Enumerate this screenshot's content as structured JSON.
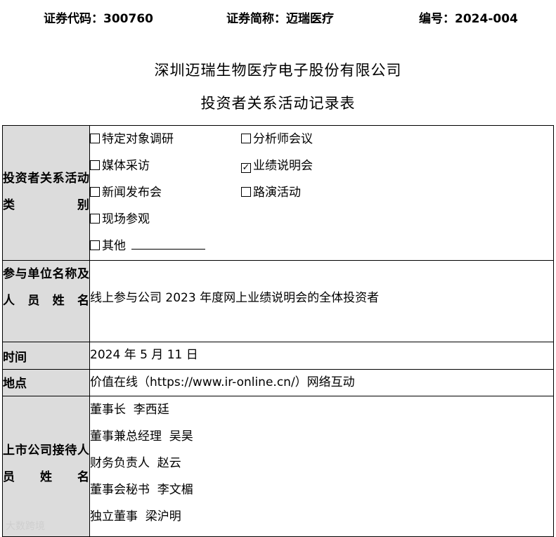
{
  "header": {
    "code": "证券代码：300760",
    "short_name": "证券简称：迈瑞医疗",
    "number": "编号：2024-004"
  },
  "titles": {
    "company": "深圳迈瑞生物医疗电子股份有限公司",
    "form": "投资者关系活动记录表"
  },
  "rows": {
    "category": {
      "label": "投资者关系活动类别",
      "options": [
        {
          "label": "特定对象调研",
          "checked": false
        },
        {
          "label": "分析师会议",
          "checked": false
        },
        {
          "label": "媒体采访",
          "checked": false
        },
        {
          "label": "业绩说明会",
          "checked": true
        },
        {
          "label": "新闻发布会",
          "checked": false
        },
        {
          "label": "路演活动",
          "checked": false
        },
        {
          "label": "现场参观",
          "checked": false
        },
        {
          "label": "其他",
          "checked": false
        }
      ]
    },
    "participants": {
      "label": "参与单位名称及人员姓名",
      "value": "线上参与公司 2023 年度网上业绩说明会的全体投资者"
    },
    "time": {
      "label": "时间",
      "value": "2024 年 5 月 11 日"
    },
    "location": {
      "label": "地点",
      "value": "价值在线（https://www.ir-online.cn/）网络互动"
    },
    "hosts": {
      "label": "上市公司接待人员姓名",
      "people": [
        "董事长  李西廷",
        "董事兼总经理  吴昊",
        "财务负责人  赵云",
        "董事会秘书  李文楣",
        "独立董事  梁沪明"
      ]
    }
  },
  "watermark": "大数跨境",
  "icons": {
    "unchecked": "☐",
    "checked": "☑"
  }
}
